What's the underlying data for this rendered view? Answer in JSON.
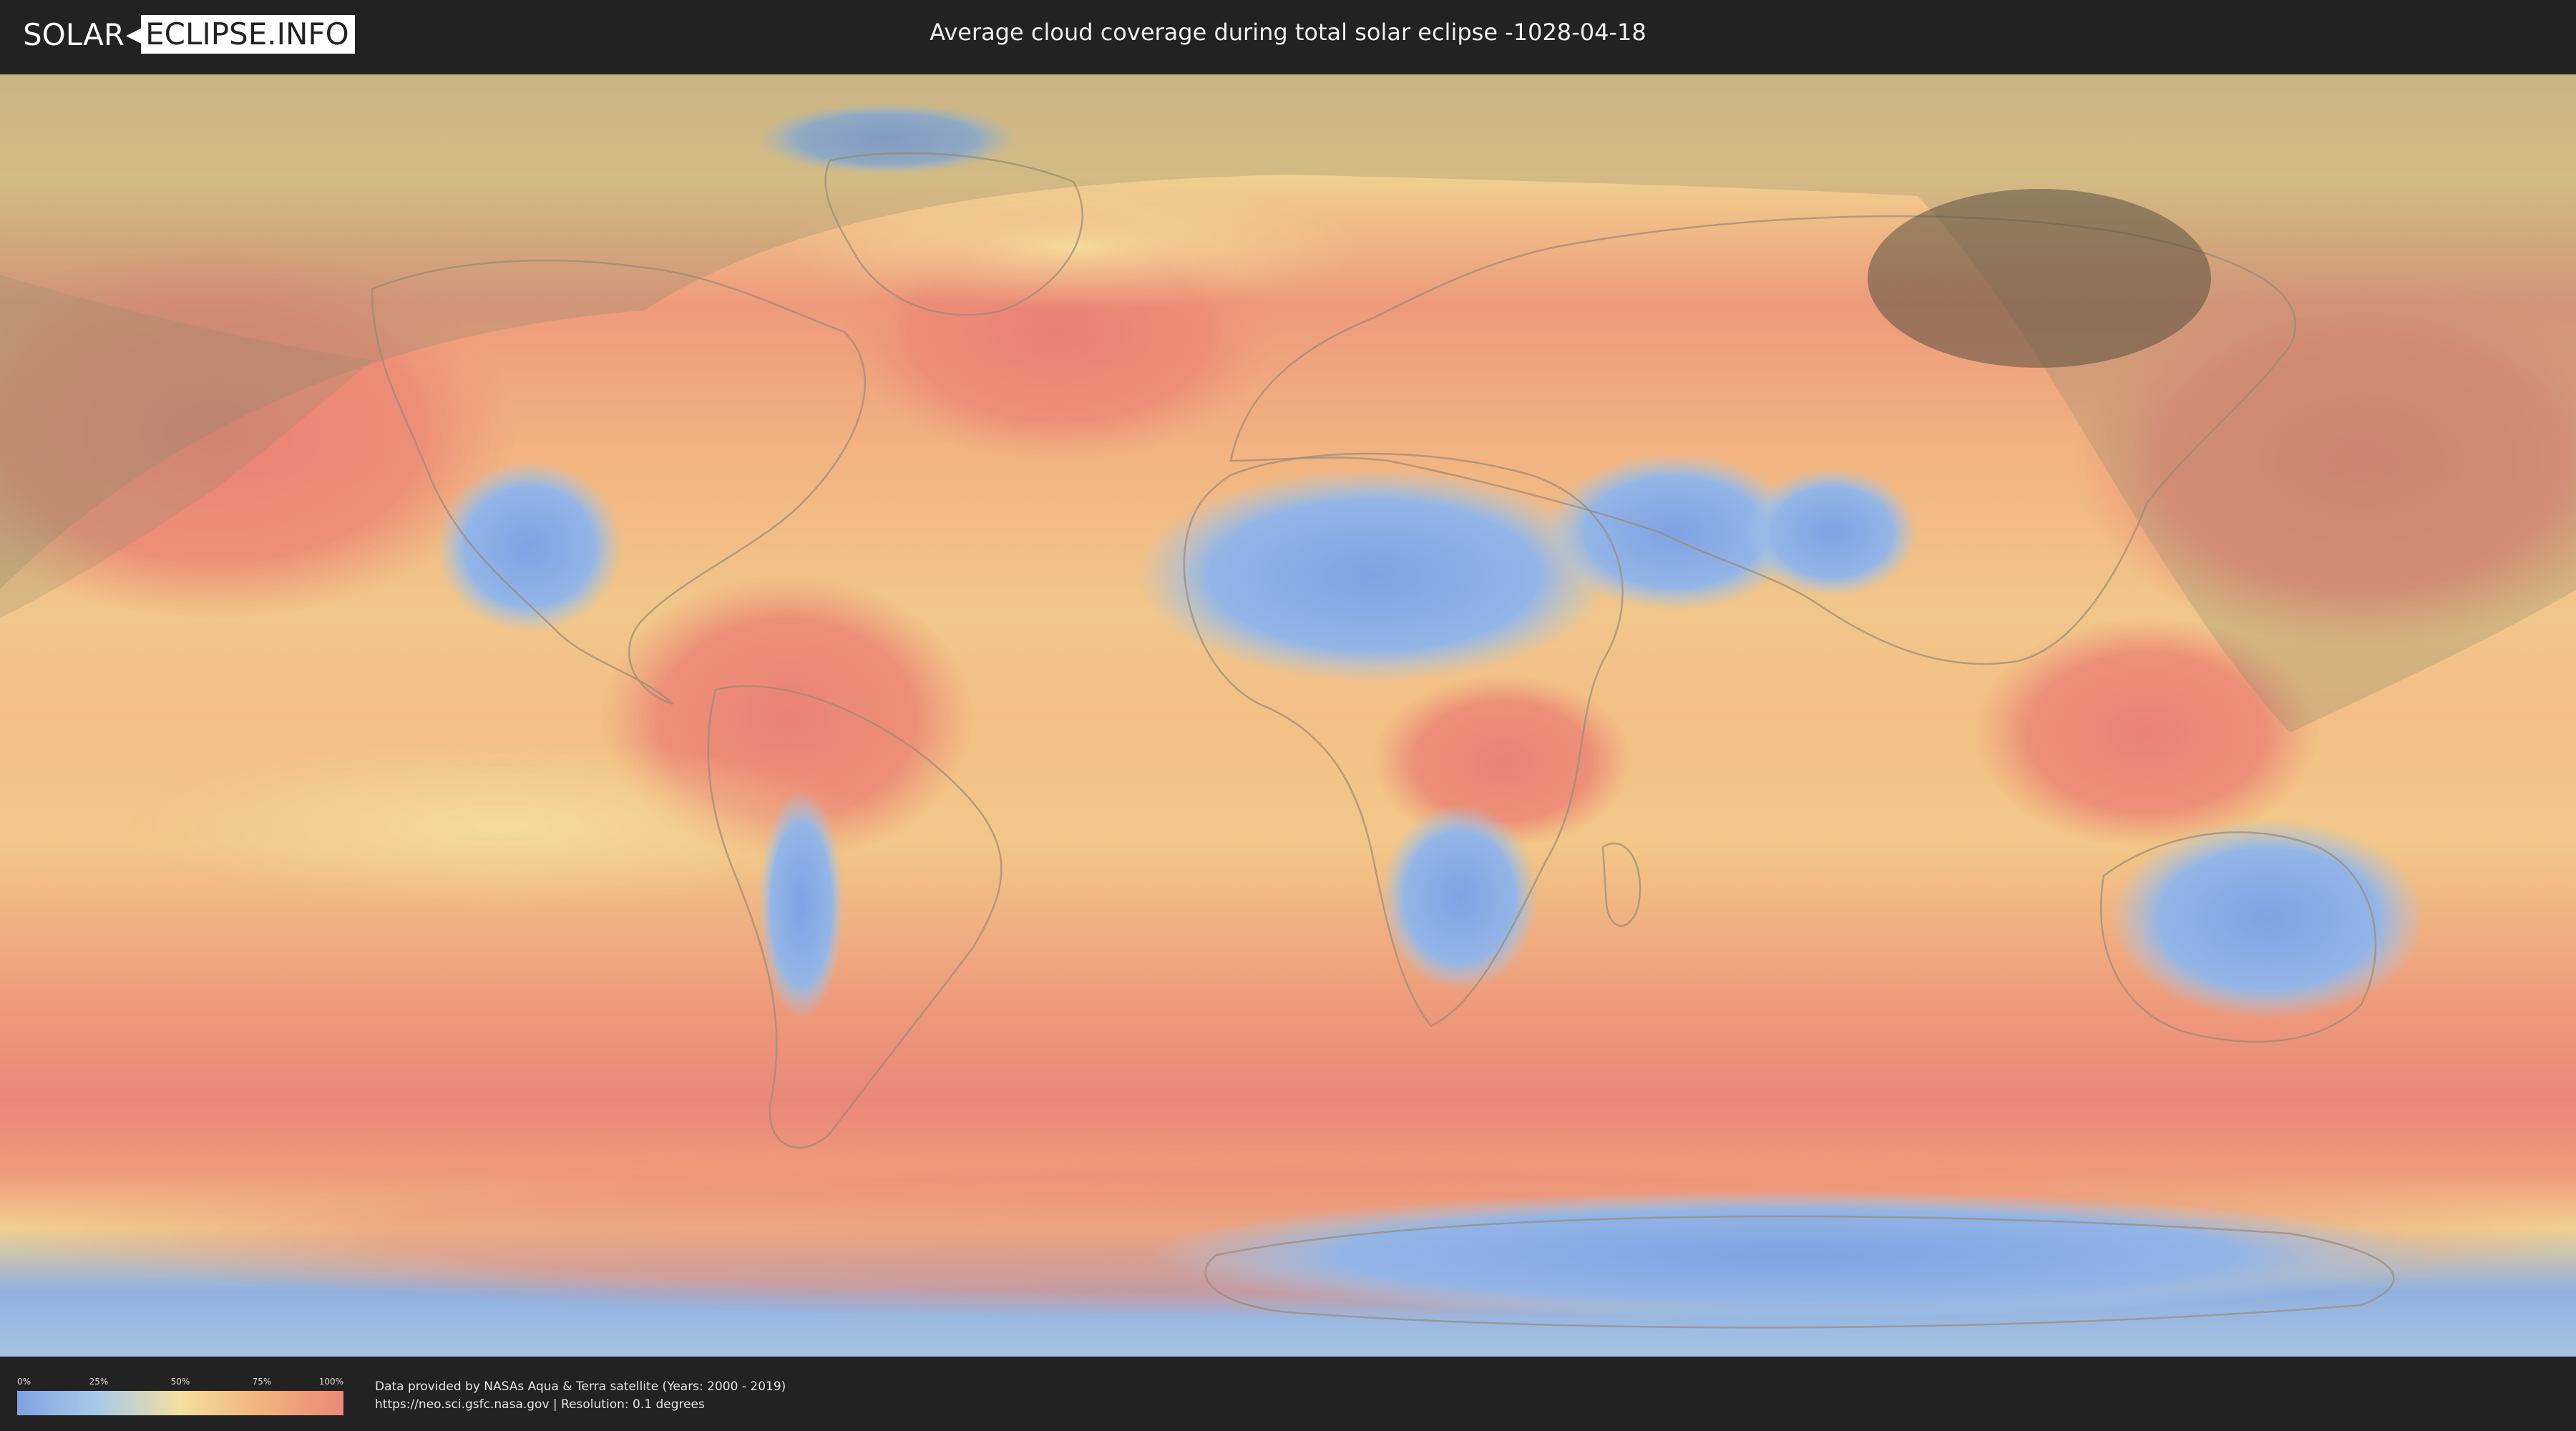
{
  "header": {
    "logo_left": "SOLAR",
    "logo_right": "ECLIPSE.INFO",
    "title": "Average cloud coverage during total solar eclipse -1028-04-18"
  },
  "map": {
    "type": "world-cloud-coverage",
    "projection": "equirectangular"
  },
  "legend": {
    "ticks": [
      "0%",
      "25%",
      "50%",
      "75%",
      "100%"
    ],
    "colors": {
      "low": "#7fa2e4",
      "quarter": "#a9cbe8",
      "mid": "#f3df9e",
      "three_quarter": "#f2b27a",
      "high": "#ec8878"
    }
  },
  "credits": {
    "line1": "Data provided by NASAs Aqua & Terra satellite (Years: 2000 - 2019)",
    "line2": "https://neo.sci.gsfc.nasa.gov | Resolution: 0.1 degrees"
  },
  "colors": {
    "background": "#222222",
    "eclipse_shadow": "#8a8a6a",
    "totality_path": "#5a5040"
  }
}
